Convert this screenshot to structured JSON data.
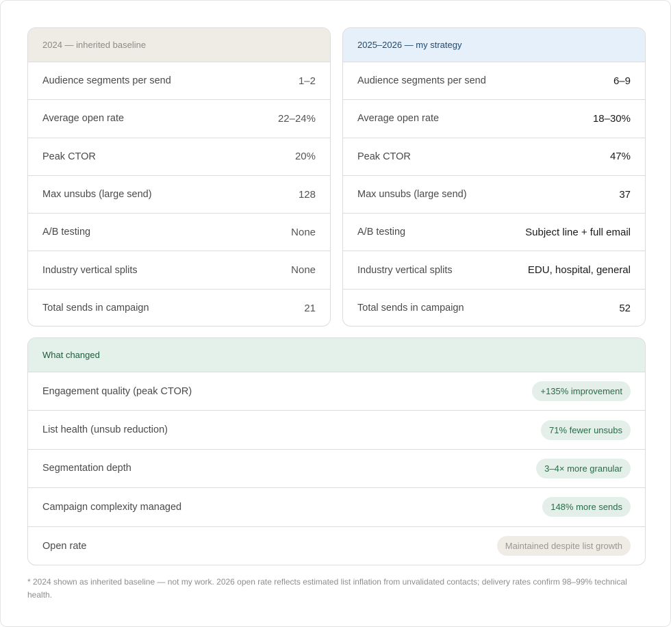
{
  "baseline": {
    "header": "2024 — inherited baseline",
    "rows": [
      {
        "label": "Audience segments per send",
        "value": "1–2"
      },
      {
        "label": "Average open rate",
        "value": "22–24%"
      },
      {
        "label": "Peak CTOR",
        "value": "20%"
      },
      {
        "label": "Max unsubs (large send)",
        "value": "128"
      },
      {
        "label": "A/B testing",
        "value": "None"
      },
      {
        "label": "Industry vertical splits",
        "value": "None"
      },
      {
        "label": "Total sends in campaign",
        "value": "21"
      }
    ]
  },
  "strategy": {
    "header": "2025–2026 — my strategy",
    "rows": [
      {
        "label": "Audience segments per send",
        "value": "6–9"
      },
      {
        "label": "Average open rate",
        "value": "18–30%"
      },
      {
        "label": "Peak CTOR",
        "value": "47%"
      },
      {
        "label": "Max unsubs (large send)",
        "value": "37"
      },
      {
        "label": "A/B testing",
        "value": "Subject line + full email"
      },
      {
        "label": "Industry vertical splits",
        "value": "EDU, hospital, general"
      },
      {
        "label": "Total sends in campaign",
        "value": "52"
      }
    ]
  },
  "changes": {
    "header": "What changed",
    "rows": [
      {
        "label": "Engagement quality (peak CTOR)",
        "badge": "+135% improvement"
      },
      {
        "label": "List health (unsub reduction)",
        "badge": "71% fewer unsubs"
      },
      {
        "label": "Segmentation depth",
        "badge": "3–4× more granular"
      },
      {
        "label": "Campaign complexity managed",
        "badge": "148% more sends"
      },
      {
        "label": "Open rate",
        "badge": "Maintained despite list growth"
      }
    ]
  },
  "footnote": "* 2024 shown as inherited baseline — not my work. 2026 open rate reflects estimated list inflation from unvalidated contacts; delivery rates confirm 98–99% technical health.",
  "colors": {
    "baseline_header_bg": "#efece6",
    "strategy_header_bg": "#e6f0fb",
    "changes_header_bg": "#e4f0ea",
    "positive_badge_bg": "#e3efe8",
    "neutral_badge_bg": "#efece6"
  }
}
